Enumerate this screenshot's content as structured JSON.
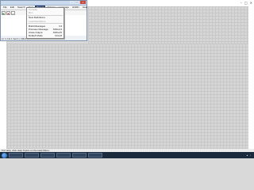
{
  "window": {
    "title": ""
  },
  "menubar": [
    {
      "label": "File",
      "active": false
    },
    {
      "label": "Edit",
      "active": false
    },
    {
      "label": "Search",
      "active": false
    },
    {
      "label": "View",
      "active": false
    },
    {
      "label": "Project",
      "active": true
    },
    {
      "label": "Options",
      "active": false
    },
    {
      "label": "Language",
      "active": false
    },
    {
      "label": "HitWin",
      "active": false
    },
    {
      "label": "Help",
      "active": false
    }
  ],
  "toolbar": [
    "play-icon",
    "stop-icon",
    "new-icon"
  ],
  "dropdown": [
    {
      "label": "Compile",
      "shortcut": "",
      "disabled": true
    },
    {
      "label": "Run",
      "shortcut": "",
      "disabled": true
    },
    {
      "sep": true
    },
    {
      "label": "New Definitions",
      "shortcut": "",
      "disabled": false
    },
    {
      "label": "Load Definitions",
      "shortcut": "",
      "disabled": true
    },
    {
      "sep": true
    },
    {
      "label": "Build Messages",
      "shortcut": "F4",
      "disabled": false
    },
    {
      "label": "Previous Message",
      "shortcut": "Shift+F4",
      "disabled": false
    },
    {
      "label": "Close Output",
      "shortcut": "Shift+F5",
      "disabled": false
    },
    {
      "label": "Default Mode",
      "shortcut": "Ctrl+M",
      "disabled": false
    }
  ],
  "statusline": "Ln 1 Col 1 Sel 0 | CRLF | INS",
  "footer": "For Help, click Help Topics on the Help Menu.",
  "taskbar": {
    "tasks": [
      "",
      "",
      "",
      "",
      "",
      ""
    ],
    "clock": ""
  }
}
